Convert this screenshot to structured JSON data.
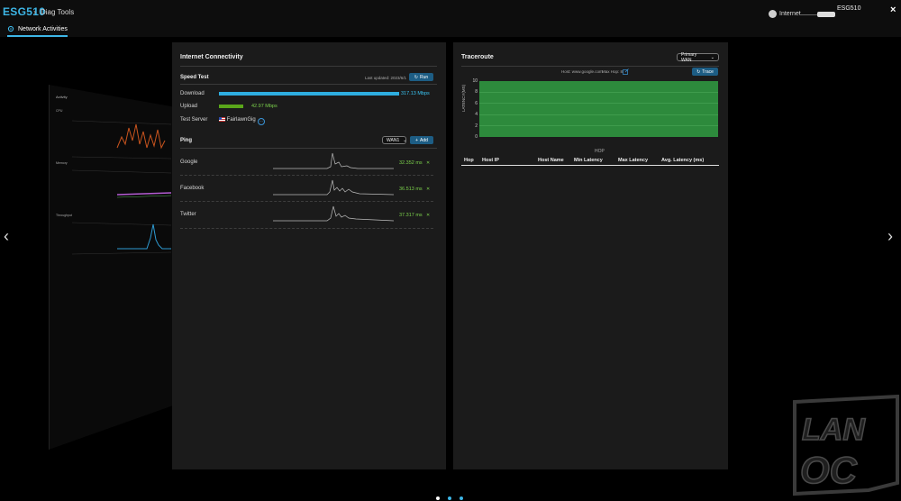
{
  "header": {
    "brand": "ESG510",
    "breadcrumb": "Diag Tools",
    "subtab": "Network Activities",
    "internet_label": "Internet",
    "device_label": "ESG510",
    "close": "×"
  },
  "connectivity": {
    "title": "Internet Connectivity",
    "speed_test": {
      "label": "Speed Test",
      "last_updated": "Last updated: 2023/6/1",
      "run_label": "Run",
      "download_label": "Download",
      "download_value": "317.13 Mbps",
      "download_fraction": 1.0,
      "upload_label": "Upload",
      "upload_value": "42.97 Mbps",
      "upload_fraction": 0.135,
      "server_label": "Test Server",
      "server_name": "FairlawnGig"
    },
    "ping": {
      "label": "Ping",
      "wan_select": "WAN1",
      "add_label": "Add",
      "targets": [
        {
          "name": "Google",
          "value": "32.352 ms"
        },
        {
          "name": "Facebook",
          "value": "36.513 ms"
        },
        {
          "name": "Twitter",
          "value": "37.317 ms"
        }
      ]
    }
  },
  "traceroute": {
    "title": "Traceroute",
    "wan_select": "Primary WAN",
    "host_info": "Host: www.google.com",
    "max_hop": "Max Hop: 8",
    "trace_label": "Trace",
    "ylabel": "LATENCY(MS)",
    "xlabel": "HOP",
    "yticks": [
      "10",
      "8",
      "6",
      "4",
      "2",
      "0"
    ],
    "columns": [
      "Hop",
      "Host IP",
      "Host Name",
      "Min Latency",
      "Max Latency",
      "Avg. Latency (ms)"
    ]
  },
  "side_panel": {
    "title": "Activity",
    "sections": [
      "CPU",
      "Memory",
      "Throughput"
    ]
  },
  "nav": {
    "prev": "‹",
    "next": "›"
  },
  "colors": {
    "accent": "#3db6e6",
    "download": "#2eaee0",
    "upload": "#5aa61a",
    "chart_fill": "#2d8a3c"
  }
}
